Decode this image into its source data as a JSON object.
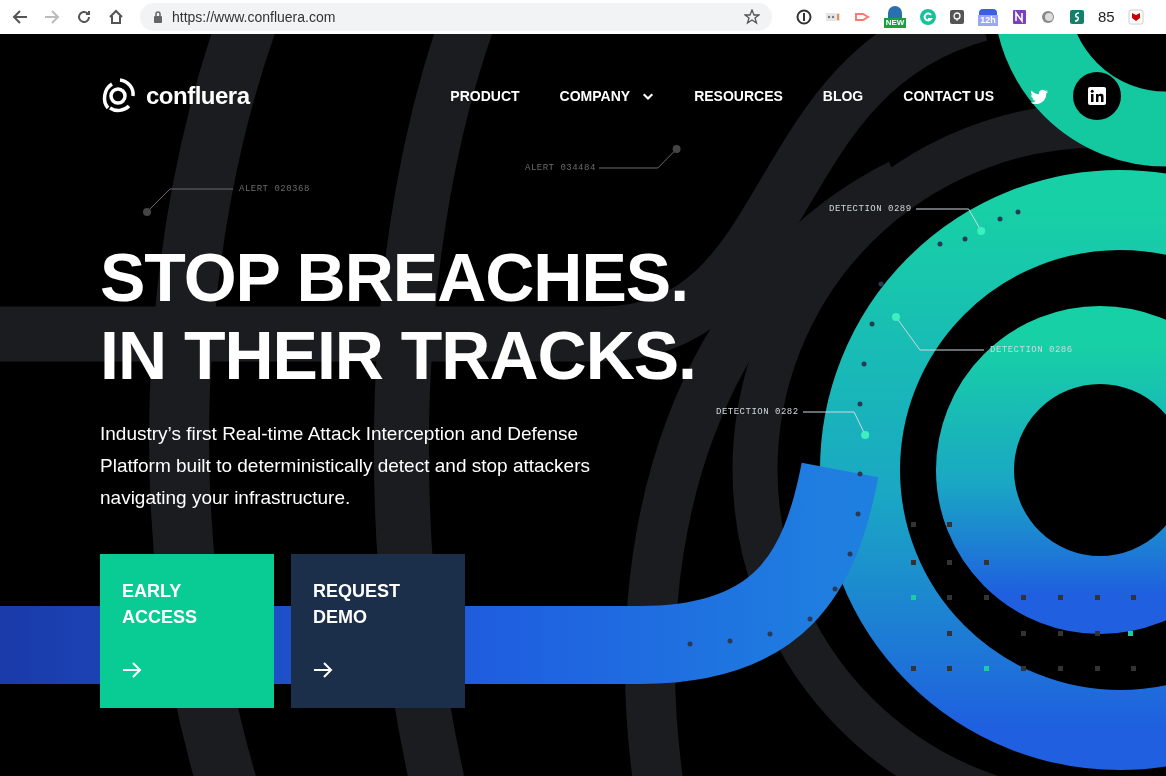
{
  "browser": {
    "url": "https://www.confluera.com",
    "forward_disabled": true,
    "extension_badges": [
      {
        "kind": "new",
        "text": "NEW"
      },
      {
        "kind": "timer",
        "text": "12h"
      },
      {
        "kind": "count",
        "text": "85"
      }
    ]
  },
  "nav": {
    "logo": "confluera",
    "items": [
      {
        "label": "PRODUCT",
        "dropdown": false
      },
      {
        "label": "COMPANY",
        "dropdown": true
      },
      {
        "label": "RESOURCES",
        "dropdown": false
      },
      {
        "label": "BLOG",
        "dropdown": false
      },
      {
        "label": "CONTACT US",
        "dropdown": false
      }
    ]
  },
  "hero": {
    "headline": [
      "STOP BREACHES.",
      "IN THEIR TRACKS."
    ],
    "description": "Industry’s first Real-time Attack Interception and Defense Platform built to deterministically detect and stop attackers navigating your infrastructure.",
    "buttons": [
      {
        "label": "EARLY ACCESS",
        "kind": "primary"
      },
      {
        "label": "REQUEST DEMO",
        "kind": "secondary"
      }
    ],
    "callouts": [
      {
        "label": "ALERT 020368",
        "kind": "alert"
      },
      {
        "label": "ALERT 034484",
        "kind": "alert"
      },
      {
        "label": "DETECTION 0289",
        "kind": "detection"
      },
      {
        "label": "DETECTION 0286",
        "kind": "detection"
      },
      {
        "label": "DETECTION 0282",
        "kind": "detection"
      }
    ]
  }
}
